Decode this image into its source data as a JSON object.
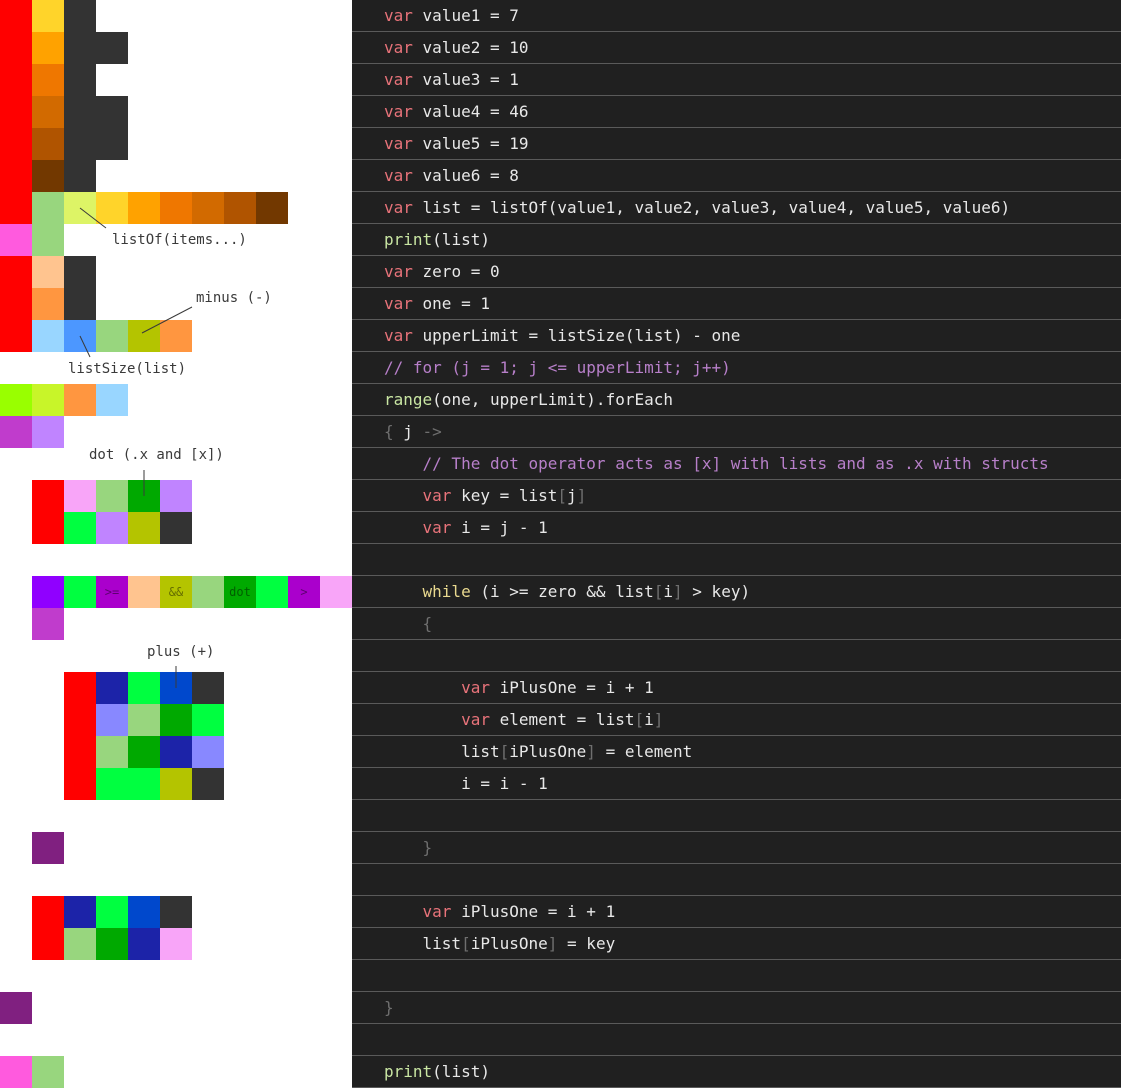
{
  "colors": {
    "red": "#ff0000",
    "yellow": "#ffd42a",
    "orange": "#ffa200",
    "dark_orange": "#ef7700",
    "burnt_orange": "#d26a00",
    "rust": "#b05400",
    "brown": "#8a4000",
    "dark_brown": "#723800",
    "charcoal": "#333333",
    "charcoal_2": "#3a3a3a",
    "light_green": "#98d67e",
    "lime": "#ddf466",
    "magenta_pink": "#ff5ade",
    "peach": "#ffc48f",
    "light_orange": "#ff9640",
    "sky_blue": "#99d6ff",
    "blue": "#4c97ff",
    "olive": "#b4c400",
    "chartreuse": "#99ff00",
    "lime_2": "#c8f529",
    "purple": "#c03ccc",
    "lavender": "#c084ff",
    "light_pink": "#f8a5f8",
    "green": "#00a900",
    "bright_green": "#00ff40",
    "violet": "#9000ff",
    "dark_violet": "#aa00cc",
    "navy": "#1c23a8",
    "mid_blue": "#0048cc",
    "periwinkle": "#8888ff",
    "plum": "#802080",
    "code_bg": "#202020",
    "code_divider": "#5a5a5a",
    "keyword": "#e8737a",
    "function": "#c9e6a3",
    "comment": "#b77fc9",
    "dim": "#6f6f6f",
    "loop": "#e9d98f",
    "text": "#e8e8e8"
  },
  "annotations": {
    "list_of": "listOf(items...)",
    "minus": "minus (-)",
    "list_size": "listSize(list)",
    "dot": "dot (.x and [x])",
    "plus": "plus (+)"
  },
  "cell_labels": {
    "gte": ">=",
    "and": "&&",
    "dot": "dot",
    "gt": ">"
  },
  "code": {
    "lines": [
      [
        {
          "t": "var",
          "c": "keyword"
        },
        {
          "t": " value1 = 7"
        }
      ],
      [
        {
          "t": "var",
          "c": "keyword"
        },
        {
          "t": " value2 = 10"
        }
      ],
      [
        {
          "t": "var",
          "c": "keyword"
        },
        {
          "t": " value3 = 1"
        }
      ],
      [
        {
          "t": "var",
          "c": "keyword"
        },
        {
          "t": " value4 = 46"
        }
      ],
      [
        {
          "t": "var",
          "c": "keyword"
        },
        {
          "t": " value5 = 19"
        }
      ],
      [
        {
          "t": "var",
          "c": "keyword"
        },
        {
          "t": " value6 = 8"
        }
      ],
      [
        {
          "t": "var",
          "c": "keyword"
        },
        {
          "t": " list = "
        },
        {
          "t": "listOf",
          "c": "plain"
        },
        {
          "t": "(value1, value2, value3, value4, value5, value6)"
        }
      ],
      [
        {
          "t": "print",
          "c": "func"
        },
        {
          "t": "(list)"
        }
      ],
      [
        {
          "t": "var",
          "c": "keyword"
        },
        {
          "t": " zero = 0"
        }
      ],
      [
        {
          "t": "var",
          "c": "keyword"
        },
        {
          "t": " one = 1"
        }
      ],
      [
        {
          "t": "var",
          "c": "keyword"
        },
        {
          "t": " upperLimit = listSize(list) - one"
        }
      ],
      [
        {
          "t": "// for (j = 1; j <= upperLimit; j++)",
          "c": "comment"
        }
      ],
      [
        {
          "t": "range",
          "c": "func"
        },
        {
          "t": "(one, upperLimit).forEach"
        }
      ],
      [
        {
          "t": "{ ",
          "c": "dim"
        },
        {
          "t": "j"
        },
        {
          "t": " ->",
          "c": "dim"
        }
      ],
      [
        {
          "t": "    "
        },
        {
          "t": "// The ",
          "c": "comment"
        },
        {
          "t": "dot operator",
          "c": "comment"
        },
        {
          "t": " acts as [x] with lists and as .x with structs",
          "c": "comment"
        }
      ],
      [
        {
          "t": "    "
        },
        {
          "t": "var",
          "c": "keyword"
        },
        {
          "t": " key = list"
        },
        {
          "t": "[",
          "c": "dim"
        },
        {
          "t": "j"
        },
        {
          "t": "]",
          "c": "dim"
        }
      ],
      [
        {
          "t": "    "
        },
        {
          "t": "var",
          "c": "keyword"
        },
        {
          "t": " i = j - 1"
        }
      ],
      [],
      [
        {
          "t": "    "
        },
        {
          "t": "while",
          "c": "loop"
        },
        {
          "t": " (i >= zero && list"
        },
        {
          "t": "[",
          "c": "dim"
        },
        {
          "t": "i"
        },
        {
          "t": "]",
          "c": "dim"
        },
        {
          "t": " > key)"
        }
      ],
      [
        {
          "t": "    "
        },
        {
          "t": "{",
          "c": "dim"
        }
      ],
      [],
      [
        {
          "t": "        "
        },
        {
          "t": "var",
          "c": "keyword"
        },
        {
          "t": " iPlusOne = i + 1"
        }
      ],
      [
        {
          "t": "        "
        },
        {
          "t": "var",
          "c": "keyword"
        },
        {
          "t": " element = list"
        },
        {
          "t": "[",
          "c": "dim"
        },
        {
          "t": "i"
        },
        {
          "t": "]",
          "c": "dim"
        }
      ],
      [
        {
          "t": "        "
        },
        {
          "t": "list"
        },
        {
          "t": "[",
          "c": "dim"
        },
        {
          "t": "iPlusOne"
        },
        {
          "t": "]",
          "c": "dim"
        },
        {
          "t": " = element"
        }
      ],
      [
        {
          "t": "        "
        },
        {
          "t": "i = i - 1"
        }
      ],
      [],
      [
        {
          "t": "    "
        },
        {
          "t": "}",
          "c": "dim"
        }
      ],
      [],
      [
        {
          "t": "    "
        },
        {
          "t": "var",
          "c": "keyword"
        },
        {
          "t": " iPlusOne = i + 1"
        }
      ],
      [
        {
          "t": "    "
        },
        {
          "t": "list"
        },
        {
          "t": "[",
          "c": "dim"
        },
        {
          "t": "iPlusOne"
        },
        {
          "t": "]",
          "c": "dim"
        },
        {
          "t": " = key"
        }
      ],
      [],
      [
        {
          "t": "}",
          "c": "dim"
        }
      ],
      [],
      [
        {
          "t": "print",
          "c": "func"
        },
        {
          "t": "(list)"
        }
      ]
    ]
  }
}
